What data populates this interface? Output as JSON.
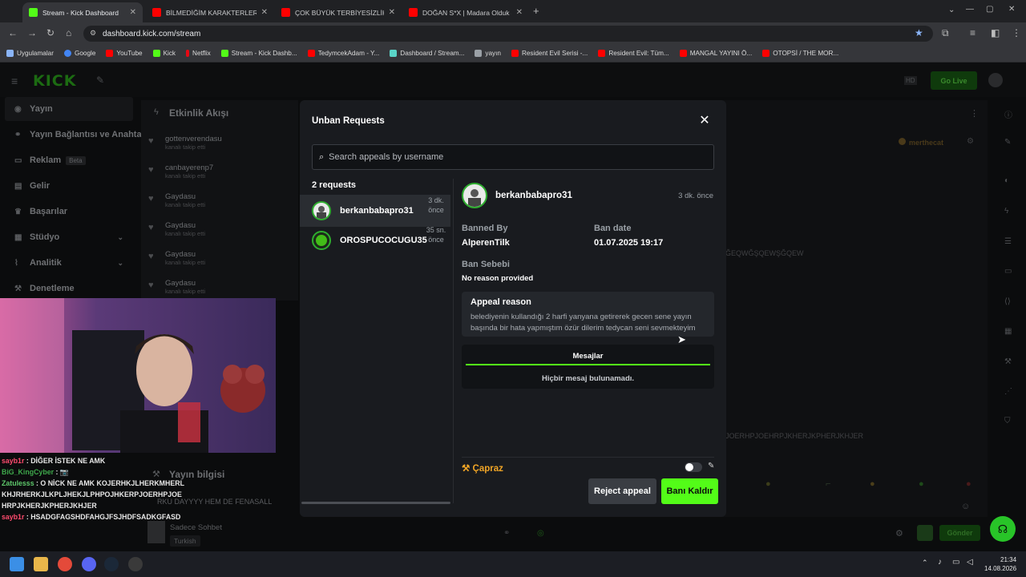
{
  "browser": {
    "tabs": [
      {
        "title": "Stream - Kick Dashboard",
        "color": "#53fc18"
      },
      {
        "title": "BİLMEDİĞİM KARAKTERLER İLE",
        "color": "#ff0000"
      },
      {
        "title": "ÇOK BÜYÜK TERBİYESİZLİK BEN",
        "color": "#ff0000"
      },
      {
        "title": "DOĞAN S*X | Madara Olduk #7",
        "color": "#ff0000"
      }
    ],
    "url": "dashboard.kick.com/stream",
    "bookmarks": [
      {
        "label": "Uygulamalar",
        "color": "#8ab4f8"
      },
      {
        "label": "Google",
        "color": "#4285f4"
      },
      {
        "label": "YouTube",
        "color": "#ff0000"
      },
      {
        "label": "Kick",
        "color": "#53fc18"
      },
      {
        "label": "Netflix",
        "color": "#e50914"
      },
      {
        "label": "Stream - Kick Dashb...",
        "color": "#53fc18"
      },
      {
        "label": "TedymcekAdam - Y...",
        "color": "#ff0000"
      },
      {
        "label": "Dashboard / Stream...",
        "color": "#5ad5c8"
      },
      {
        "label": "yayın",
        "color": "#9aa0a6"
      },
      {
        "label": "Resident Evil Serisi -...",
        "color": "#ff0000"
      },
      {
        "label": "Resident Evil: Tüm...",
        "color": "#ff0000"
      },
      {
        "label": "MANGAL YAYINI Ö...",
        "color": "#ff0000"
      },
      {
        "label": "OTOPSİ / THE MOR...",
        "color": "#ff0000"
      }
    ]
  },
  "kick": {
    "logo": "KICK",
    "go_live": "Go Live",
    "sidebar": [
      {
        "label": "Yayın",
        "icon": "broadcast-icon"
      },
      {
        "label": "Yayın Bağlantısı ve Anahtarı",
        "icon": "link-icon"
      },
      {
        "label": "Reklam",
        "badge": "Beta",
        "icon": "ad-icon"
      },
      {
        "label": "Gelir",
        "icon": "money-icon"
      },
      {
        "label": "Başarılar",
        "icon": "trophy-icon"
      },
      {
        "label": "Stüdyo",
        "icon": "studio-icon"
      },
      {
        "label": "Analitik",
        "icon": "analytics-icon"
      },
      {
        "label": "Denetleme",
        "icon": "moderation-icon"
      }
    ],
    "activity": {
      "title": "Etkinlik Akışı",
      "items": [
        {
          "name": "gottenverendasu",
          "sub": "kanalı takip etti"
        },
        {
          "name": "canbayerenp7",
          "sub": "kanalı takip etti"
        },
        {
          "name": "Gaydasu",
          "sub": "kanalı takip etti"
        },
        {
          "name": "Gaydasu",
          "sub": "kanalı takip etti"
        },
        {
          "name": "Gaydasu",
          "sub": "kanalı takip etti"
        },
        {
          "name": "Gaydasu",
          "sub": "kanalı takip etti"
        }
      ]
    },
    "chat_user_top": "merthecat",
    "faint_line1": "ĞEQWĞŞQEWŞĞQEW",
    "faint_line2": "JOERHPJOEHRPJKHERJKPHERJKHJER",
    "stream_info": {
      "title": "Yayın bilgisi",
      "stream_title": "RKU DAYYYY HEM DE FENASALL",
      "category": "Sadece Sohbet",
      "tag": "Turkish"
    },
    "chat_lines": [
      {
        "user": "sayb1r",
        "text": "DİĞER İSTEK NE AMK",
        "cls": "u1"
      },
      {
        "user": "BiG_KingCyber",
        "text": "📷",
        "cls": "u2"
      },
      {
        "user": "Zatulesss",
        "text": "O NİCK NE AMK KOJERHKJLHERKMHERLKHJRHERKJLKPLJHEKJLPHPOJHKERPJOERHPJOEHRPJKHERJKPHERJKHJER",
        "cls": "u3"
      },
      {
        "user": "sayb1r",
        "text": "HSADGFAGSHDFAHGJFSJHDFSADKGFASD",
        "cls": "u1"
      }
    ],
    "send": "Gönder"
  },
  "modal": {
    "title": "Unban Requests",
    "search_placeholder": "Search appeals by username",
    "request_count": "2 requests",
    "requests": [
      {
        "username": "berkanbabapro31",
        "time": "3 dk. önce"
      },
      {
        "username": "OROSPUCOCUGU35",
        "time": "35 sn. önce"
      }
    ],
    "detail": {
      "username": "berkanbabapro31",
      "time": "3 dk. önce",
      "banned_by_label": "Banned By",
      "banned_by": "AlperenTilk",
      "ban_date_label": "Ban date",
      "ban_date": "01.07.2025 19:17",
      "reason_label": "Ban Sebebi",
      "reason": "No reason provided",
      "appeal_title": "Appeal reason",
      "appeal_text": "belediyenin kullandığı 2 harfi yanyana getirerek gecen sene yayın başında bir hata yapmıştım özür dilerim tedycan seni sevmekteyim",
      "messages_tab": "Mesajlar",
      "messages_empty": "Hiçbir mesaj bulunamadı.",
      "cross_label": "Çapraz"
    },
    "reject_label": "Reject appeal",
    "unban_label": "Banı Kaldır"
  },
  "taskbar": {
    "time": "21:34",
    "date": "14.08.2026"
  }
}
